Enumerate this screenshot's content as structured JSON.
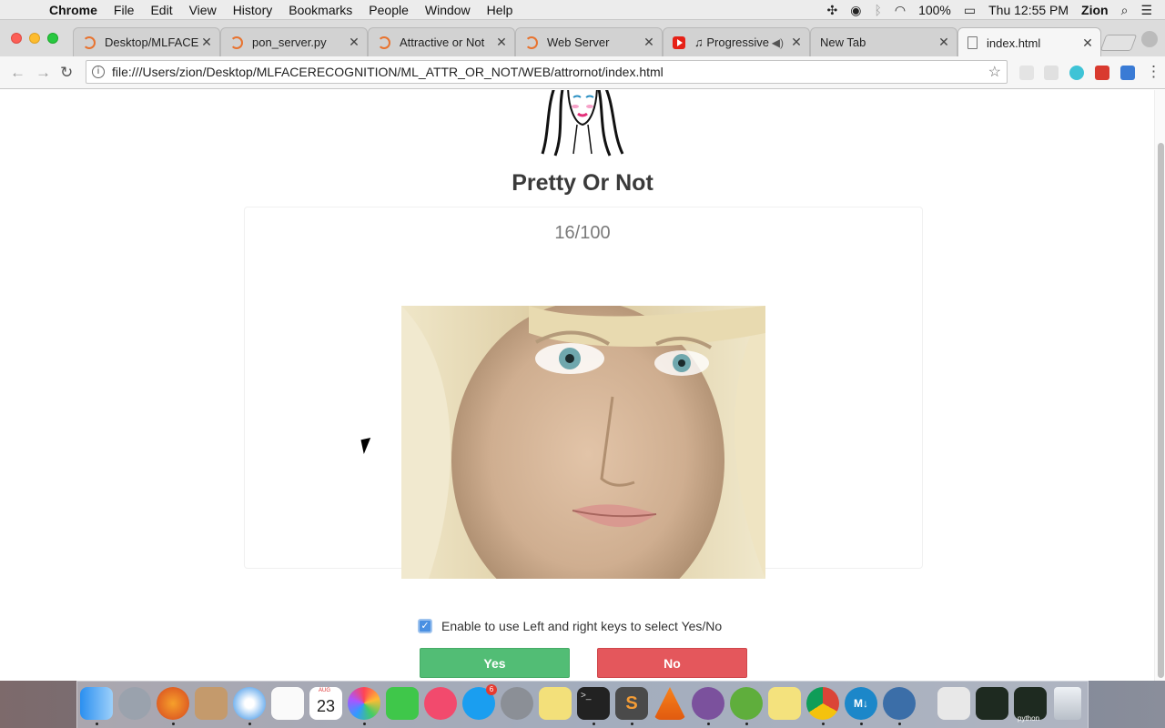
{
  "menubar": {
    "app_name": "Chrome",
    "menus": [
      "File",
      "Edit",
      "View",
      "History",
      "Bookmarks",
      "People",
      "Window",
      "Help"
    ],
    "battery": "100%",
    "clock": "Thu 12:55 PM",
    "user": "Zion"
  },
  "tabs": [
    {
      "title": "Desktop/MLFACER",
      "favicon": "loading-icon"
    },
    {
      "title": "pon_server.py",
      "favicon": "loading-icon"
    },
    {
      "title": "Attractive or Not",
      "favicon": "loading-icon"
    },
    {
      "title": "Web Server",
      "favicon": "loading-icon"
    },
    {
      "title": "♫ Progressive T",
      "favicon": "youtube-icon",
      "audio": true
    },
    {
      "title": "New Tab",
      "favicon": "none"
    },
    {
      "title": "index.html",
      "favicon": "document-icon",
      "active": true
    }
  ],
  "address_bar": {
    "url": "file:///Users/zion/Desktop/MLFACERECOGNITION/ML_ATTR_OR_NOT/WEB/attrornot/index.html"
  },
  "page": {
    "title": "Pretty Or Not",
    "counter": "16/100",
    "keyboard_toggle": {
      "label": "Enable to use Left and right keys to select Yes/No",
      "checked": true
    },
    "yes_label": "Yes",
    "no_label": "No"
  },
  "colors": {
    "yes_button": "#52bd75",
    "no_button": "#e4575c",
    "checkbox": "#4a90e2"
  },
  "dock": {
    "calendar_month": "AUG",
    "calendar_day": "23",
    "app_store_badge": "6",
    "python_label": "python"
  }
}
